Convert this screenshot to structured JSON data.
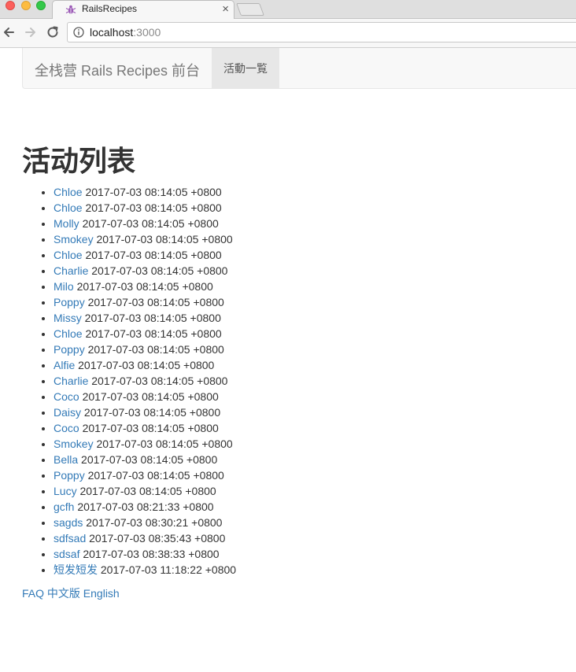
{
  "browser": {
    "tab_title": "RailsRecipes",
    "close_glyph": "×",
    "url_host": "localhost",
    "url_port": ":3000"
  },
  "navbar": {
    "brand": "全栈营 Rails Recipes 前台",
    "active_item": "活動一覧"
  },
  "main": {
    "heading": "活动列表",
    "events": [
      {
        "name": "Chloe",
        "time": "2017-07-03 08:14:05 +0800"
      },
      {
        "name": "Chloe",
        "time": "2017-07-03 08:14:05 +0800"
      },
      {
        "name": "Molly",
        "time": "2017-07-03 08:14:05 +0800"
      },
      {
        "name": "Smokey",
        "time": "2017-07-03 08:14:05 +0800"
      },
      {
        "name": "Chloe",
        "time": "2017-07-03 08:14:05 +0800"
      },
      {
        "name": "Charlie",
        "time": "2017-07-03 08:14:05 +0800"
      },
      {
        "name": "Milo",
        "time": "2017-07-03 08:14:05 +0800"
      },
      {
        "name": "Poppy",
        "time": "2017-07-03 08:14:05 +0800"
      },
      {
        "name": "Missy",
        "time": "2017-07-03 08:14:05 +0800"
      },
      {
        "name": "Chloe",
        "time": "2017-07-03 08:14:05 +0800"
      },
      {
        "name": "Poppy",
        "time": "2017-07-03 08:14:05 +0800"
      },
      {
        "name": "Alfie",
        "time": "2017-07-03 08:14:05 +0800"
      },
      {
        "name": "Charlie",
        "time": "2017-07-03 08:14:05 +0800"
      },
      {
        "name": "Coco",
        "time": "2017-07-03 08:14:05 +0800"
      },
      {
        "name": "Daisy",
        "time": "2017-07-03 08:14:05 +0800"
      },
      {
        "name": "Coco",
        "time": "2017-07-03 08:14:05 +0800"
      },
      {
        "name": "Smokey",
        "time": "2017-07-03 08:14:05 +0800"
      },
      {
        "name": "Bella",
        "time": "2017-07-03 08:14:05 +0800"
      },
      {
        "name": "Poppy",
        "time": "2017-07-03 08:14:05 +0800"
      },
      {
        "name": "Lucy",
        "time": "2017-07-03 08:14:05 +0800"
      },
      {
        "name": "gcfh",
        "time": "2017-07-03 08:21:33 +0800"
      },
      {
        "name": "sagds",
        "time": "2017-07-03 08:30:21 +0800"
      },
      {
        "name": "sdfsad",
        "time": "2017-07-03 08:35:43 +0800"
      },
      {
        "name": "sdsaf",
        "time": "2017-07-03 08:38:33 +0800"
      },
      {
        "name": "短发短发",
        "time": "2017-07-03 11:18:22 +0800"
      }
    ]
  },
  "footer": {
    "faq": "FAQ",
    "chinese": "中文版",
    "english": "English"
  }
}
